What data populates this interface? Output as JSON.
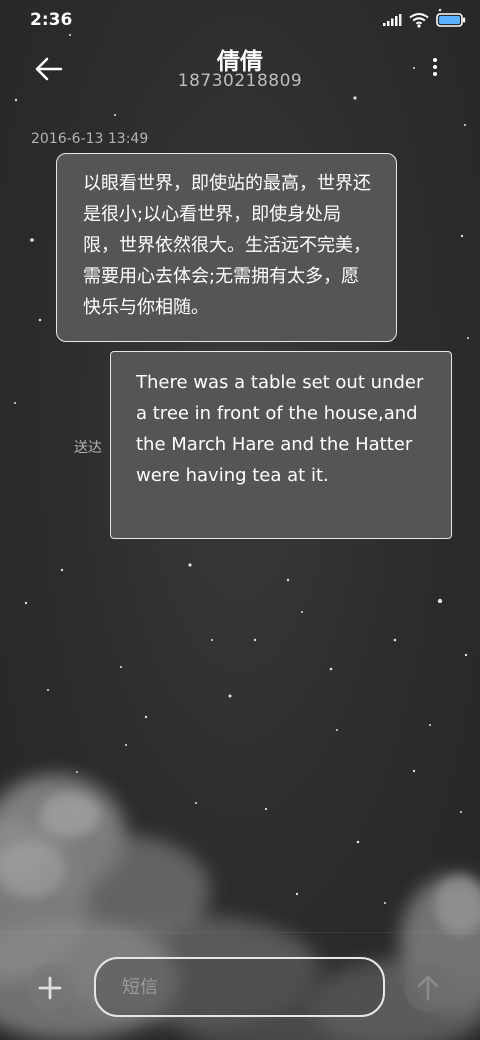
{
  "status_bar": {
    "time": "2:36",
    "icons": [
      "signal-icon",
      "wifi-icon",
      "battery-icon"
    ],
    "battery_color": "#5ab0ff"
  },
  "header": {
    "contact_name": "倩倩",
    "contact_number": "18730218809",
    "back_icon": "arrow-left-icon",
    "more_icon": "more-vertical-icon"
  },
  "conversation": {
    "timestamp": "2016-6-13 13:49",
    "received_message": "以眼看世界，即使站的最高，世界还是很小;以心看世界，即使身处局限，世界依然很大。生活远不完美，需要用心去体会;无需拥有太多，愿快乐与你相随。",
    "sent_message": "There was a table set out under a tree in front of the house,and the March Hare and the Hatter were having tea at it.",
    "sent_status": "送达"
  },
  "composer": {
    "placeholder": "短信",
    "add_icon": "plus-icon",
    "send_icon": "arrow-up-icon"
  },
  "theme": {
    "background": "#2e2e2e",
    "bubble_fill": "#555555",
    "bubble_border": "#e6e6e6",
    "secondary_text": "#b3b3b3"
  }
}
